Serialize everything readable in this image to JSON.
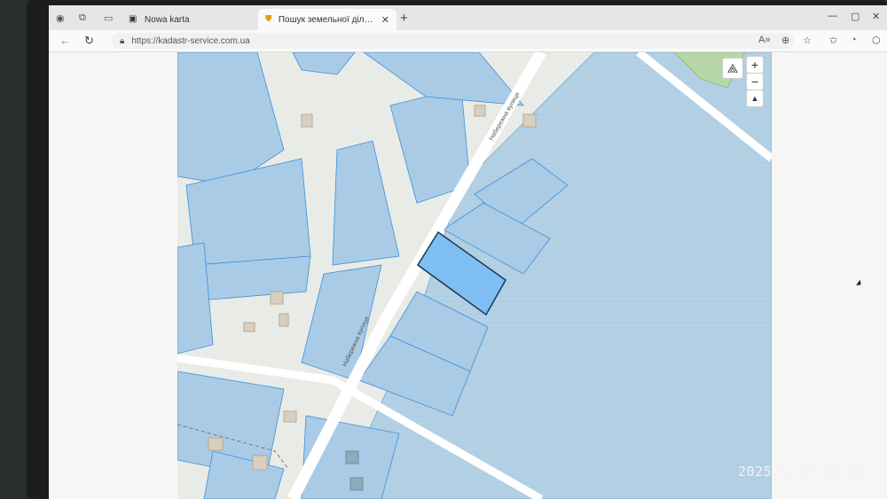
{
  "browser": {
    "tabs": [
      {
        "label": "Nowa karta",
        "active": false
      },
      {
        "label": "Пошук земельної ділянки в Дер",
        "active": true
      }
    ],
    "url": "https://kadastr-service.com.ua"
  },
  "map": {
    "street_labels": [
      "Набережна вулиця",
      "Набережна вулиця"
    ],
    "zoom_in": "+",
    "zoom_out": "−",
    "compass": "▲"
  },
  "photo_timestamp": "2025/3/15  11:40",
  "colors": {
    "parcel_fill": "#a9cbe6",
    "parcel_stroke": "#3d8fdd",
    "selected_parcel": "#7fbef2",
    "water": "#b7d3e6",
    "road": "#ffffff",
    "land": "#e9ebe6",
    "green": "#b7d7a8"
  }
}
